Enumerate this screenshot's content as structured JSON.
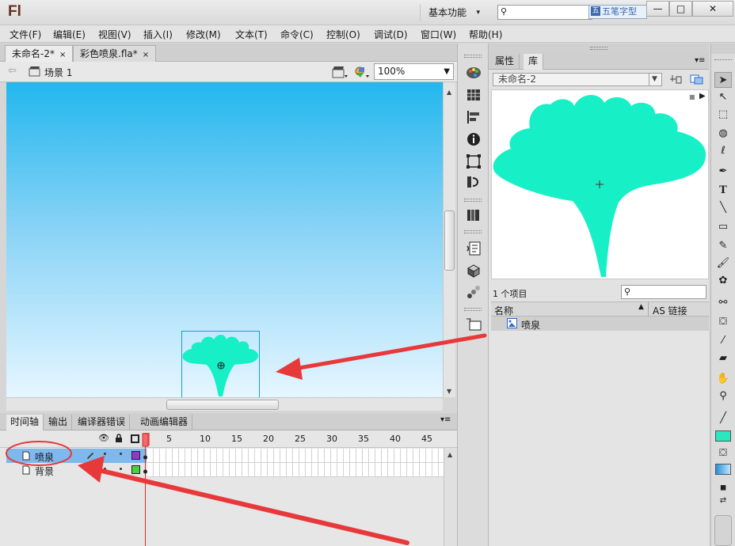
{
  "app": {
    "logo": "Fl",
    "workspace": "基本功能",
    "ime_label": "五笔字型",
    "window_buttons": [
      "—",
      "□",
      "✕"
    ]
  },
  "menu": [
    "文件(F)",
    "编辑(E)",
    "视图(V)",
    "插入(I)",
    "修改(M)",
    "文本(T)",
    "命令(C)",
    "控制(O)",
    "调试(D)",
    "窗口(W)",
    "帮助(H)"
  ],
  "document_tabs": [
    {
      "label": "未命名-2*",
      "close": "×"
    },
    {
      "label": "彩色喷泉.fla*",
      "close": "×"
    }
  ],
  "editbar": {
    "scene": "场景 1",
    "zoom": "100%"
  },
  "timeline": {
    "tabs": [
      "时间轴",
      "输出",
      "编译器错误",
      "动画编辑器"
    ],
    "frame_numbers": [
      "1",
      "5",
      "10",
      "15",
      "20",
      "25",
      "30",
      "35",
      "40",
      "45"
    ],
    "layers": [
      {
        "name": "喷泉",
        "color": "#8a3cc8",
        "selected": true
      },
      {
        "name": "背景",
        "color": "#4ccf3c",
        "selected": false
      }
    ]
  },
  "library": {
    "tabs": [
      "属性",
      "库"
    ],
    "document": "未命名-2",
    "item_count": "1 个项目",
    "columns": {
      "name": "名称",
      "linkage": "AS 链接"
    },
    "items": [
      {
        "name": "喷泉"
      }
    ]
  },
  "colors": {
    "fountain": "#17f0c6",
    "stage_top": "#22b7ee",
    "stage_bottom": "#e6f6ff",
    "annotation": "#e8393a",
    "fill_swatch": "#2ce6bf"
  }
}
